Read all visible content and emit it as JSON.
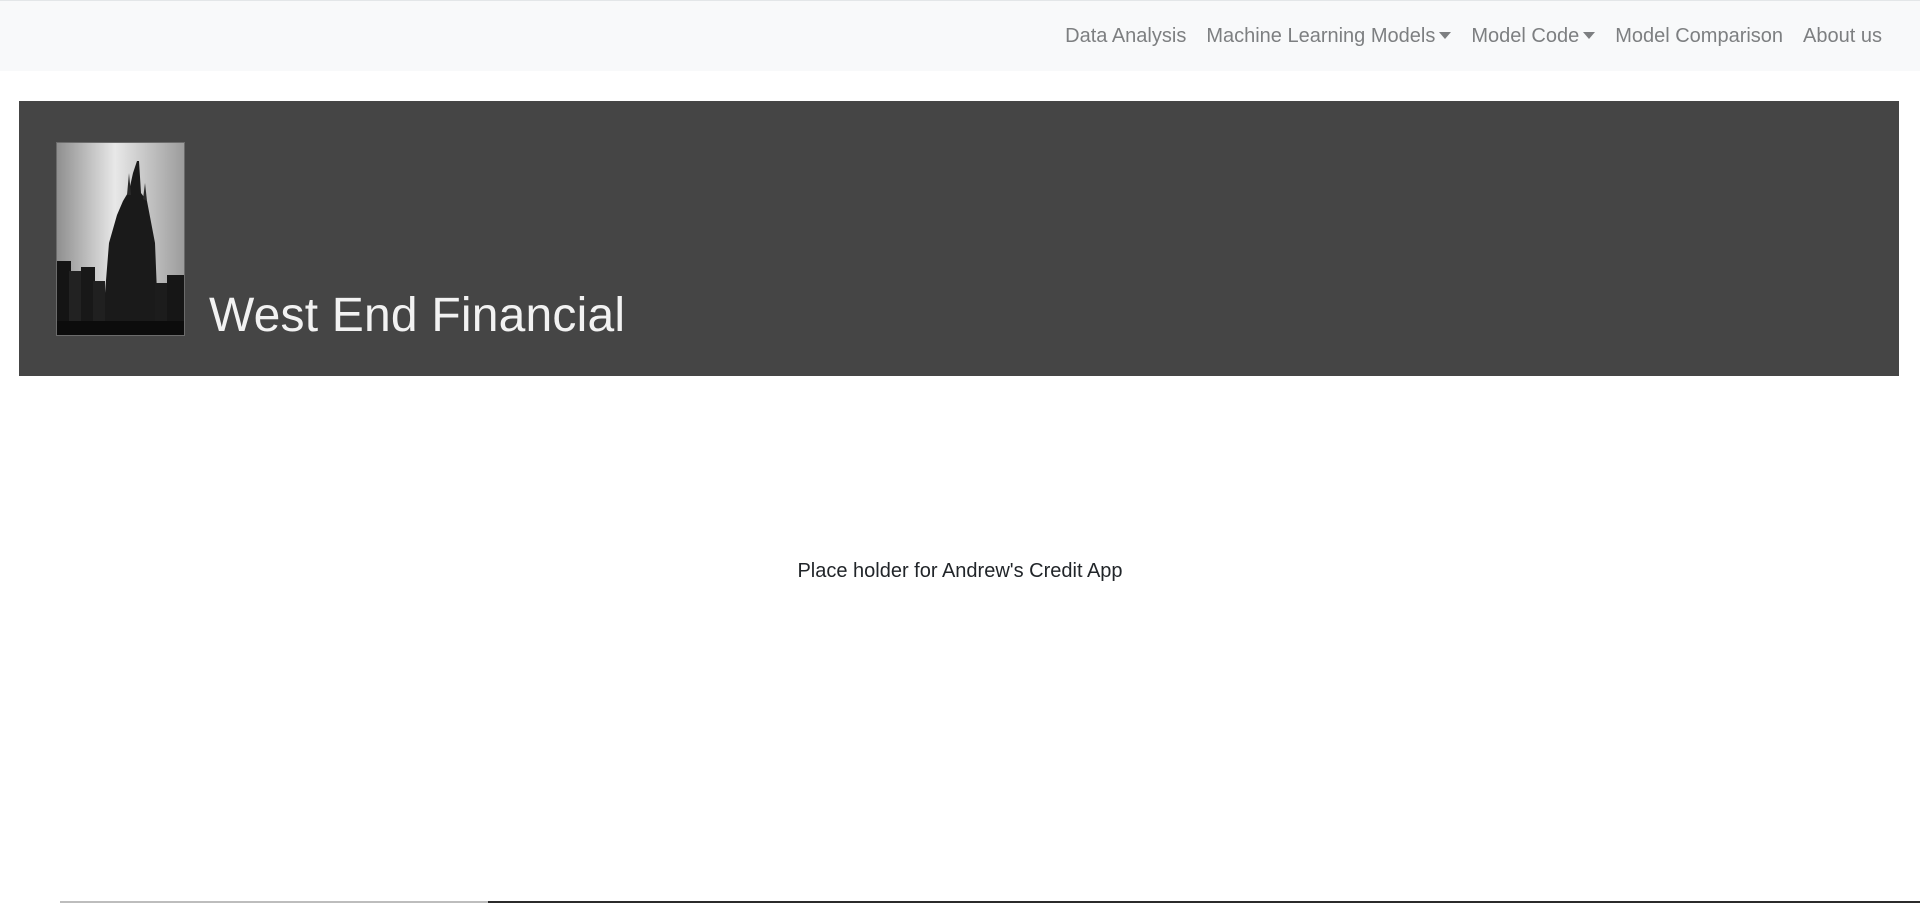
{
  "navbar": {
    "items": [
      {
        "label": "Data Analysis",
        "dropdown": false
      },
      {
        "label": "Machine Learning Models",
        "dropdown": true
      },
      {
        "label": "Model Code",
        "dropdown": true
      },
      {
        "label": "Model Comparison",
        "dropdown": false
      },
      {
        "label": "About us",
        "dropdown": false
      }
    ]
  },
  "jumbotron": {
    "logo_icon": "building-silhouette-icon",
    "title": "West End Financial"
  },
  "main": {
    "placeholder": "Place holder for Andrew's Credit App"
  },
  "colors": {
    "navbar_bg": "#f8f9fa",
    "nav_link": "#7d7f81",
    "jumbotron_bg": "#454545",
    "title_text": "#f2f2f2"
  }
}
